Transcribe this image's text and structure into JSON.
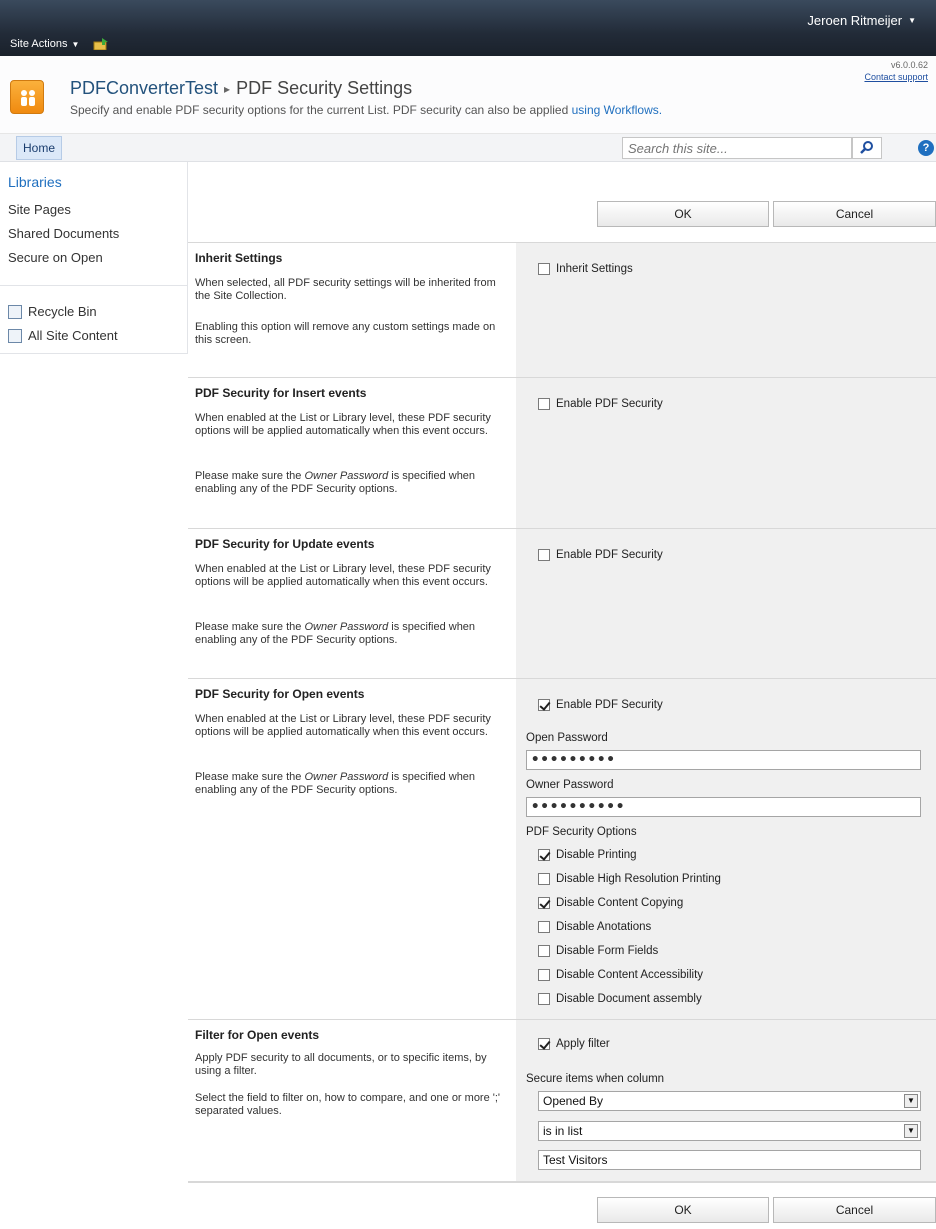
{
  "topbar": {
    "site_actions": "Site Actions",
    "user": "Jeroen Ritmeijer"
  },
  "header": {
    "site": "PDFConverterTest",
    "separator": "▸",
    "page": "PDF Security Settings",
    "description": "Specify and enable PDF security options for the current List. PDF security can also be applied",
    "link": "using Workflows.",
    "version": "v6.0.0.62",
    "support": "Contact support"
  },
  "topnav": {
    "home": "Home",
    "search_placeholder": "Search this site..."
  },
  "leftnav": {
    "heading": "Libraries",
    "items": [
      "Site Pages",
      "Shared Documents",
      "Secure on Open"
    ],
    "recycle": "Recycle Bin",
    "all_content": "All Site Content"
  },
  "buttons": {
    "ok": "OK",
    "cancel": "Cancel"
  },
  "sections": {
    "inherit": {
      "title": "Inherit Settings",
      "desc1": "When selected, all PDF security settings will be inherited from the Site Collection.",
      "desc2": "Enabling this option will remove any custom settings made on this screen.",
      "checkbox": "Inherit Settings"
    },
    "insert": {
      "title": "PDF Security for Insert events",
      "desc1": "When enabled at the List or Library level, these PDF security options will be applied automatically when this event occurs.",
      "desc2_pre": "Please make sure the ",
      "desc2_em": "Owner Password",
      "desc2_post": " is specified when enabling any of the PDF Security options.",
      "checkbox": "Enable PDF Security"
    },
    "update": {
      "title": "PDF Security for Update events",
      "desc1": "When enabled at the List or Library level, these PDF security options will be applied automatically when this event occurs.",
      "desc2_pre": "Please make sure the ",
      "desc2_em": "Owner Password",
      "desc2_post": " is specified when enabling any of the PDF Security options.",
      "checkbox": "Enable PDF Security"
    },
    "open": {
      "title": "PDF Security for Open events",
      "desc1": "When enabled at the List or Library level, these PDF security options will be applied automatically when this event occurs.",
      "desc2_pre": "Please make sure the ",
      "desc2_em": "Owner Password",
      "desc2_post": " is specified when enabling any of the PDF Security options.",
      "checkbox": "Enable PDF Security",
      "open_password_label": "Open Password",
      "open_password_value": "•••••••••",
      "owner_password_label": "Owner Password",
      "owner_password_value": "••••••••••",
      "options_label": "PDF Security Options",
      "options": [
        {
          "label": "Disable Printing",
          "checked": true
        },
        {
          "label": "Disable High Resolution Printing",
          "checked": false
        },
        {
          "label": "Disable Content Copying",
          "checked": true
        },
        {
          "label": "Disable Anotations",
          "checked": false
        },
        {
          "label": "Disable Form Fields",
          "checked": false
        },
        {
          "label": "Disable Content Accessibility",
          "checked": false
        },
        {
          "label": "Disable Document assembly",
          "checked": false
        }
      ]
    },
    "filter": {
      "title": "Filter for Open events",
      "desc1": "Apply PDF security to all documents, or to specific items, by using a filter.",
      "desc2": "Select the field to filter on, how to compare, and one or more ';' separated values.",
      "checkbox": "Apply filter",
      "column_label": "Secure items when column",
      "column_value": "Opened By",
      "compare_value": "is in list",
      "filter_value": "Test Visitors"
    }
  }
}
